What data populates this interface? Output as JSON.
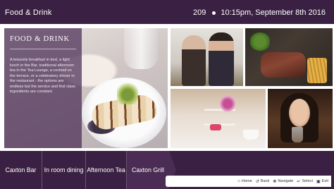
{
  "header": {
    "title": "Food & Drink",
    "room_number": "209",
    "datetime": "10:15pm, September 8th 2016"
  },
  "panel": {
    "title": "Food & Drink",
    "body": "A leisurely breakfast in bed, a light lunch in the Bar, traditional afternoon tea in the Tea Lounge, a cocktail on the terrace, or a celebratory dinner in the restaurant - the options are endless but the service and first class ingredients are constant."
  },
  "nav": {
    "tabs": [
      {
        "label": "Caxton Bar"
      },
      {
        "label": "In room dining"
      },
      {
        "label": "Afternoon Tea"
      },
      {
        "label": "Caxton Grill"
      }
    ]
  },
  "help": {
    "home": "Home",
    "back": "Back",
    "navigate": "Navigate",
    "select": "Select",
    "exit": "Exit"
  },
  "icons": {
    "home": "home-icon",
    "back": "back-icon",
    "navigate": "navigate-arrows-icon",
    "select": "select-icon",
    "exit": "exit-icon"
  },
  "colors": {
    "brand_purple": "#3a2042",
    "panel_purple": "#4a2c54"
  }
}
